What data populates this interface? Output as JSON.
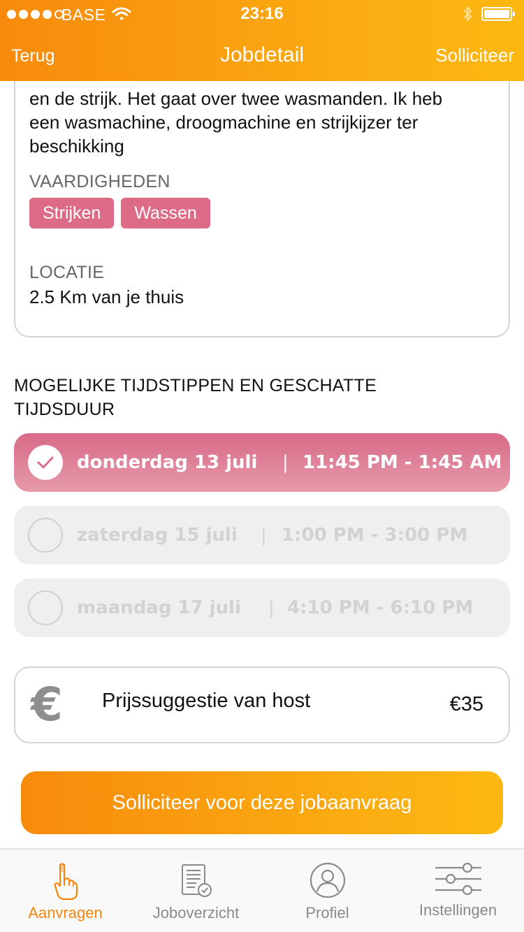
{
  "status_bar": {
    "carrier": "BASE",
    "time": "23:16"
  },
  "nav": {
    "back_label": "Terug",
    "title": "Jobdetail",
    "apply_label": "Solliciteer"
  },
  "description": {
    "lines": [
      "en de strijk. Het gaat over twee wasmanden. Ik heb",
      "een wasmachine, droogmachine en strijkijzer ter",
      "beschikking"
    ]
  },
  "skills": {
    "heading": "VAARDIGHEDEN",
    "items": [
      "Strijken",
      "Wassen"
    ]
  },
  "location": {
    "heading": "LOCATIE",
    "value": "2.5 Km van je thuis"
  },
  "times": {
    "heading_line1": "MOGELIJKE TIJDSTIPPEN EN GESCHATTE",
    "heading_line2": "TIJDSDUUR",
    "separator": "|",
    "slots": [
      {
        "day": "donderdag 13 juli",
        "time": "11:45 PM - 1:45 AM",
        "selected": true
      },
      {
        "day": "zaterdag 15 juli",
        "time": "1:00 PM - 3:00 PM",
        "selected": false
      },
      {
        "day": "maandag 17 juli",
        "time": "4:10 PM - 6:10 PM",
        "selected": false
      }
    ]
  },
  "price": {
    "icon": "euro-icon",
    "symbol": "€",
    "label": "Prijssuggestie van host",
    "value": "€35"
  },
  "cta": {
    "label": "Solliciteer voor deze jobaanvraag"
  },
  "tabbar": {
    "items": [
      {
        "label": "Aanvragen",
        "icon": "pointing-hand-icon",
        "active": true
      },
      {
        "label": "Joboverzicht",
        "icon": "document-check-icon",
        "active": false
      },
      {
        "label": "Profiel",
        "icon": "user-icon",
        "active": false
      },
      {
        "label": "Instellingen",
        "icon": "sliders-icon",
        "active": false
      }
    ]
  },
  "colors": {
    "brand_orange": "#f88a0c",
    "brand_yellow": "#fcb811",
    "accent_pink": "#dd6a86",
    "inactive_gray": "#efefef"
  }
}
